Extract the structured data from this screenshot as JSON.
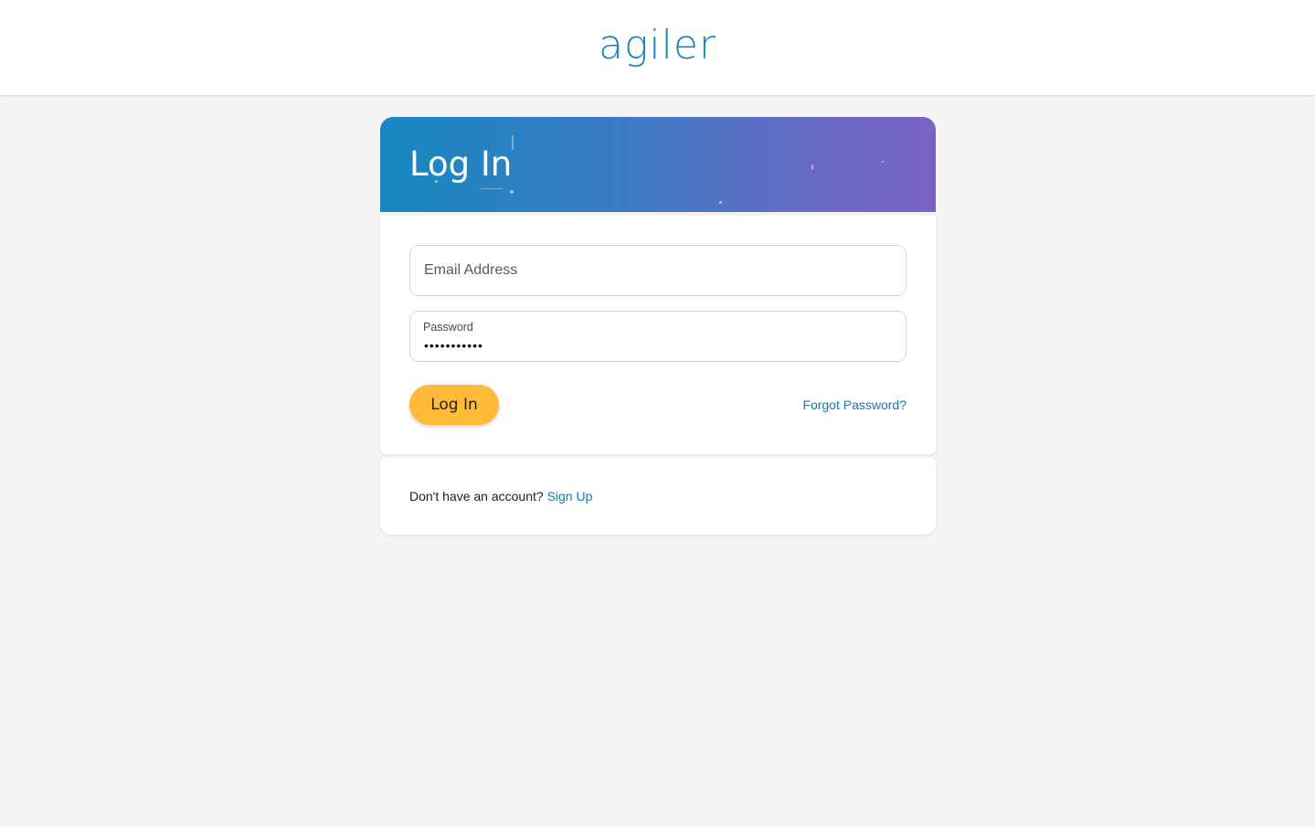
{
  "brand": {
    "logo_text": "agiler",
    "color": "#1a86b8"
  },
  "header": {
    "title": "Log In",
    "gradient_start": "#1788bf",
    "gradient_end": "#7b63c5"
  },
  "form": {
    "email": {
      "placeholder": "Email Address",
      "value": ""
    },
    "password": {
      "label": "Password",
      "value": "•••••••••••"
    },
    "submit_label": "Log In",
    "submit_color": "#ffbb38",
    "forgot_label": "Forgot Password?"
  },
  "signup": {
    "prompt": "Don't have an account?",
    "link_label": "Sign Up"
  },
  "colors": {
    "background": "#f4f4f4",
    "link": "#1479ad"
  }
}
